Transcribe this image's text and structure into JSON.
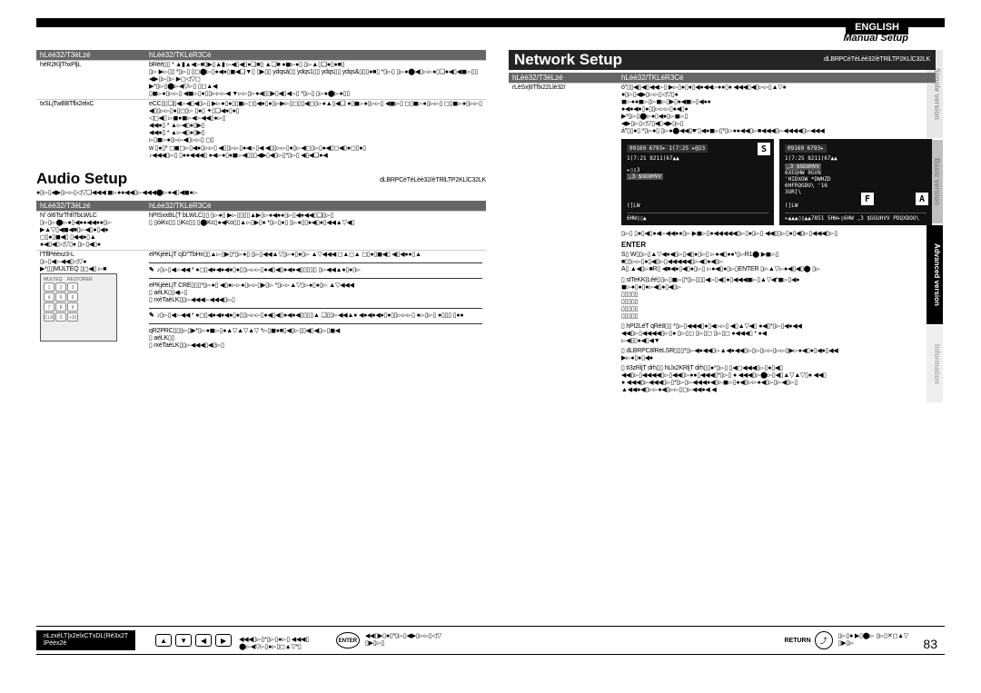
{
  "header": {
    "language": "ENGLISH",
    "breadcrumb": "Manual Setup"
  },
  "side_tabs": {
    "simple": "Simple version",
    "basic": "Basic version",
    "advanced": "Advanced version",
    "info": "Information"
  },
  "table_headers": {
    "items": "hLèè32/T3èLzé",
    "contents": "hLèè32/TKLèR3Cé"
  },
  "left": {
    "row1_item": "hèR2KljThxPljL",
    "row1_desc": "bRéé▯▯ * ▲▮▲◀▻■▯▶▯▲▮ ▻◀▯◀▯●❏■▯ ▲❏■ ●◼▻●▯ ▯▻▲▯❏●▯●■▯",
    "row1_body": "▯▻ ▶▻▯▯ *▯▻▯ ▯◻⬤▻▯●◀●▯◼◀❏▼▯ ▯▶▯▯ ydqsá▯▯ ydqs1▯▯ ydqs▯▯ ydqs&▯▯▯●■▯ *▯▻▯ ▯▻●⬤◀▯▻▻●▯❏●◀▯◀◼▻▯▯ ◀▶▯▻▯▻ ▶◻◁▽◻\n▶*▯▻▯⬤▻◀▽▻▯ ▯◻▲◀\n▯◼▻●▯▻▻▯ ◀◼▻▯●▯▯▻▻▻◀ ▼▻▻▯▻●◀▯▯▶▯◀▯◀▻▯ *▯▻▯ ▯▻●⬤▻●▯▯",
    "row2_item": "txSLjTwBBTflx2elxC",
    "row2_desc": "eCC▯▯❏▯◀▻◀▯◀▯▻▯ ▶▻●▯●▯▯◼▻◻▯◀●▯●▯▻▶▻▯◻▯▯◀◻▯▻●▲▯◀❏\n●▯◼▻●▯▻▻▯ ◀◼▻▯ ◻▯◼▻●▯▻▻▯ ◻▯◼▻●▯▻▻▯ ◀▯▯▻▻▯●▯◻▯▻ ▯●▯ ✦▯❏◀●▯●▯",
    "row2_body": "◁◻◀▯ ▻◼●◼▻◀▻◀◀▯●▻▯\n◀◀●▯ * ▲▻◀▯●▯▶▯\n◀◀●▯ * ▲▻◀▯●▯▶▯\n▻▯◼▻●▯▻▻◀▯▻▻▯ ◻▯\nw ▯●▯* ◻◼◻▻▯◀●▯▻▻▯ ◀▯▯▻▻▯●◀▻▯◀ ◀▯▯▻▻▯●▯▻◀◻▯▻▯●◀▯◻◀▯●◻▯●▯\n♪◀◀◀▯▻▯ ▯●●◀◀◀▯ ●◀▻●▯●◼▻◀▯▯▯◀▶▯◀▯▻▯*▯▻▯ ◀▯◀❏●◀",
    "audio_title": "Audio Setup",
    "audio_default": "dLBRPCèTéLèè32/èTRlLTP2KLlC32LK",
    "audio_desc": "●▯▻▯◀▶▯▻▻▯◁▽❏◀◀◀ ◼▻●●◀◀▯▻◀◀◀⬤▻●◀▯◀◼●▻",
    "audio_r1_item": "N'´óI6TsrThfiTbLWLC",
    "audio_r1_desc": "hPISxxBL(T bLWLC▯▯ ▯▻●▯ ▶▻▯▯▯▯▲▶▯▻●◀●●▯▻▯◀●◀◀▯❏▯▻▯",
    "audio_r1_body": "▯▻▯▻⬤▻●▯◀●●◀◀●●▯▻\n▶▲▽▯◀◼◀■▯▻◀▯●▯◀●\n◻▯●▯◼◀▯ ▯◀◀●▯▲\n●◀▯◀▯◁▽▯● ▯▻▯◀▯●",
    "audio_r2_item": "l'TflPéèxz3-L",
    "audio_r2_desc": "ePKjéèLjT cjD\"TbHn▯▯▲▻▯▶▯*▯▻●▯ ▯▻▯◀◀▲▽▯▻●▯●▯▻ ▲▽◀◀◀ ◻▲◻▲\n◻▯●▯◼◀▯ ◀▯◀●●▯▲",
    "audio_r2_body": "▯▻▯◀▻◀◀▯◁▽●\n▶*▯▯MULTEQ ▯◻◀▯ ▻■",
    "audio_r3_desc1": "♪▯▻▯◀▻◀◀ * ●◻▯◀●◀●◀●▯●▯▯▻▻▻▯●◀▯◀▯●◀●◀▯▯▯▯▯ ▯▻◀◀▲●▯●▯▻",
    "audio_r3_desc2": "ePKjéèLjT CRE▯▯▯*▯▻●▯ ◀▯●▻▻●▯▻▻▯▶▯▻ *▯▻▻▲▽▯▻●▯●▯▻ ▲▽◀◀◀\n▯ aéLK▯▯◀▻▯\n▯ rxèTaéLK▯▯▻◀◀◀▻◀◀◀▯▻▯",
    "audio_r3_desc3": "♪▯▻▯◀▻◀◀ * ●◻▯◀●◀●◀●▯●▯▯▻▻▻▯●◀▯◀▯●◀●◀▯▯▯▯▲ ❏▯▯▻◀◀▲●\n◀●◀●◀●▯●▯▯▻▻▻▯ ●▻▯▻▯ ●▯▯▯ ▯●●",
    "audio_r4_desc": "qR2PRC▯▯▯▻▯▶*▯▻●◼▻▯●▲▽▲▽▲▽ *▻▯◼●■▯◀▯▻▯▯◀▯◀▯▻▯◼◀\n▯ aéLK▯▯\n▯ rxèTaéLK▯▯▻◀◀◀▯◀▯▻▯"
  },
  "right": {
    "network_title": "Network Setup",
    "network_default": "dLBRPCèTéLèè32/èTRlLTP2KLlC32LK",
    "net_r1_item": "rLèSx|8Tflx22Llè32/",
    "net_r1_desc": "ó\"▯▯◀▯◀▯◀◀▻▯ ▶▻▯●▯●▯◀●◀◀▻●●▯● ◀◀◀▯◀▯▻▻▯▲▽●\n●▯▻▯◀▶▯▻▻▯◁▽▯●\n◼▻●●◼▻▯▻◼▻▯▶▯●◀◼▻▯◀●●\n●◀●◀●▯●▯▯▻▻▻▯●◀▯●\n▶*▯▻▯⬤▻●▯◀●▯▻◼▻▯\n◀▶▯▻▯◁▽▯◀▯◀▶▯▻▯\ná\"▯▯●▯ *▯▻●▯ ▯▻●⬤◀◀▯☛▯◀●◼▻▯*▯▻●●◀◀▯▻■◀◀◀▯▻◀◀◀◀▯▻◀◀◀",
    "osd1": {
      "title_code": "09169 6793▸  1(7:25  ▸@23",
      "sub_code": "1(7:21 8211(67▲▲",
      "l1": "▸▯▯3",
      "l2": ",3 $GGUHVV",
      "l3": "",
      "l4": "",
      "l5": "([LW"
    },
    "osd2": {
      "title_code": "09169 6793▸",
      "sub_code": "1(7:25 8211(67▲▲",
      "l1": ",3 $GGUHVV",
      "l2": "6XEQHW 0GVN",
      "l3": "'HIDXOW *DWHZD",
      "l4": "6HFRQGDU\\ '16",
      "l5": "3UR[\\",
      "l6": "([LW",
      "bottom": "▸▲▲▲▯▯▲▲7851 5HW▸▯6HW ,3 $GGUHVV PDQXDOO\\"
    },
    "osd_labels": {
      "S": "S",
      "F": "F",
      "A": "A"
    },
    "bottom_text1": "▯▻▯ ▯●▯◀▯●◀▻◀◀●●▯▻ ▶◼▻▯●◀◀◀◀◀▯▻▯●▯▻▯ ◀◀▯▯▻▯●▯◀▯▻▯◀◀◀▯▻▯",
    "enter_label": "ENTER",
    "enter_text": "S▯ W▯▯▻▯▲▽◀●◀▯▻▯◀▯●▯▻▯ ▻●◀▯●●*▯▻R1⬤ ▶◼▻▯\n■▯▯▻▻▯●▯◀▯▻▯◀◀◀◀◀▯▻◀▯●◀▯▻",
    "enter_text2": "A▯ ▲◀▯▻■R▯ ◀■◀●▯◀▯●▯▻▯ ▻●◀▯●▯▻▯ENTER ▯▻▲▽▻●◀▯◀▯⬤ ▯▻",
    "bullet1": "▯ stTeKK(Léé▯▯▻▯◼▻▯*▯▻▯▯▯◀▻▯◀▯●▯◀◀◀◼▻▯▲▽◀*◼▻▯◀●\n◼▻●▯●▯●▻◀▯●▯◀▯▻",
    "bullet1b": "▯▯▯▯▯\n▯▯▯▯▯\n▯▯▯▯▯\n▯▯▯▯▯",
    "bullet2": "▯ hPI2LéT qRé8▯▯ *▯▻▯◀◀◀▯●▯◀▻▻▯ ◀▯▲▽◀▯ ●◀▯*▯▻▯◀●◀◀\n◀◀▯▻▯◀◀◀◀▯▻▯● ▯▻▯◻ ▯▻▯◻ ▯▻▯◻ ●◀◀◀▯ * ●◀\n▻◀▯▯●◀▯◀▼",
    "bullet3": "▯ dLBRPC8lRèLSR▯▯▯*▯▻◀●◀◀▯▻▲◀●◀◀▯▻▯▻▯▻▻▯▻▻▯▶▻●◀▯●▯◀●▯◀◀\n▶▻●▯●▯◀●",
    "bullet4": "▯ tI3zRljT drh▯▯ hLlx2KRljT drh▯▯●*▯▻▯ ▯◀◻◀◀◀▯▻▯●▯◀▯\n◀◀▯▻▯◀◀◀◀▯▻▯◀◀▯▻●●▯◀◀◀▯*▯▻▯ ● ◀◀◀▯▻⬤▻▯◀▯▲▽▲▽▯● ◀◀▯\n● ◀◀◀▯▻◀◀◀▯▻▯*▯▻▯▻◀◀◀●◀▯▻◼▻▯●◀▯▻▻●◀▯▻▯▻◀▯▻▯\n▲◀◀●◀▯▻▻●◀▯▻▻▯◻▻◀◀●◀ ◀"
  },
  "bottom": {
    "box_line1": "nLzxéLT|x2elxCTxDL(Ré3x2T",
    "box_line2": "lPéèx2é",
    "nav_text1": "◀◀◀▯▻▯*▯▻▯●▻▯ ◀◀◀▯",
    "nav_text2": "⬤▻◀▽▻▯●▻▯◻▲▽*▯",
    "enter": "ENTER",
    "enter_text": "◀◀▯▶▯●▯*▯▻▯◀▶▯▻▻▯◁▽\n▯▶▯▻▯",
    "return": "RETURN",
    "return_text": "▯▻▯● ▶▯⬤▻ ▯▻▯✕◻▲▽\n▯▶▯▻"
  },
  "page_number": "83"
}
